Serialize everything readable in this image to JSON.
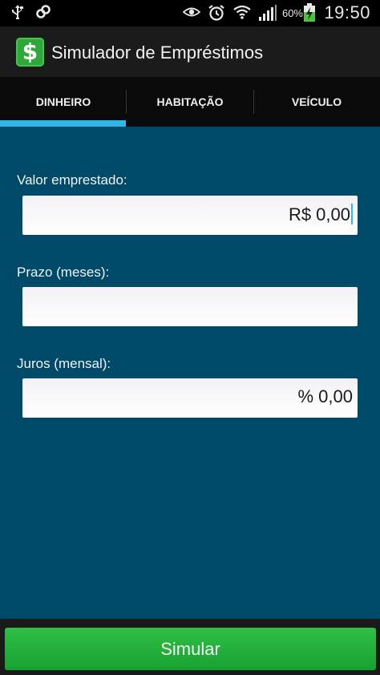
{
  "status_bar": {
    "battery_percent": "60%",
    "time": "19:50",
    "left_icons": [
      "usb-icon",
      "link-icon"
    ],
    "right_icons": [
      "eye-icon",
      "alarm-icon",
      "wifi-icon",
      "signal-icon",
      "battery-charging-icon"
    ]
  },
  "app": {
    "logo_symbol": "$",
    "title": "Simulador de Empréstimos"
  },
  "tabs": [
    {
      "label": "DINHEIRO",
      "selected": true
    },
    {
      "label": "HABITAÇÃO",
      "selected": false
    },
    {
      "label": "VEÍCULO",
      "selected": false
    }
  ],
  "form": {
    "valor": {
      "label": "Valor emprestado:",
      "value": "R$ 0,00"
    },
    "prazo": {
      "label": "Prazo (meses):",
      "value": ""
    },
    "juros": {
      "label": "Juros (mensal):",
      "value": "% 0,00"
    }
  },
  "actions": {
    "simulate_label": "Simular"
  },
  "colors": {
    "accent": "#33b5e5",
    "form_background": "#004a69",
    "button_green": "#22ad3b"
  }
}
